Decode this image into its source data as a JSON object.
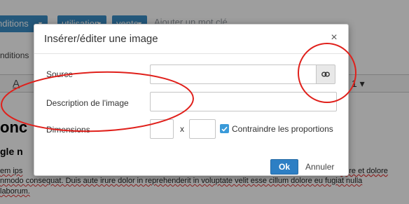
{
  "background": {
    "tags": [
      {
        "label": "nditions"
      },
      {
        "label": "utilisation"
      },
      {
        "label": "vente"
      }
    ],
    "tag_input_placeholder": "Ajouter un mot clé",
    "conditions_label": "nditions",
    "toolbar_a": "A",
    "toolbar_number": "1",
    "heading": "onc",
    "subheading": "gle n",
    "lines": [
      "em ips",
      "nmodo consequat. Duis aute irure dolor in reprehenderit in voluptate velit esse cillum dolore eu fugiat nulla",
      "laborum."
    ],
    "right_text_1": "bore et dolore",
    "right_text_2": ""
  },
  "dialog": {
    "title": "Insérer/éditer une image",
    "close_label": "×",
    "fields": {
      "source_label": "Source",
      "source_value": "",
      "description_label": "Description de l'image",
      "description_value": "",
      "dimensions_label": "Dimensions",
      "width_value": "",
      "times_label": "x",
      "height_value": "",
      "constrain_label": "Contraindre les proportions",
      "constrain_checked": true
    },
    "ok_label": "Ok",
    "cancel_label": "Annuler"
  },
  "colors": {
    "accent_blue": "#2d7fc4",
    "annotation_red": "#e0201b"
  },
  "icons": {
    "browse": "link-icon",
    "checkbox": "checkmark-icon",
    "close": "close-icon"
  }
}
